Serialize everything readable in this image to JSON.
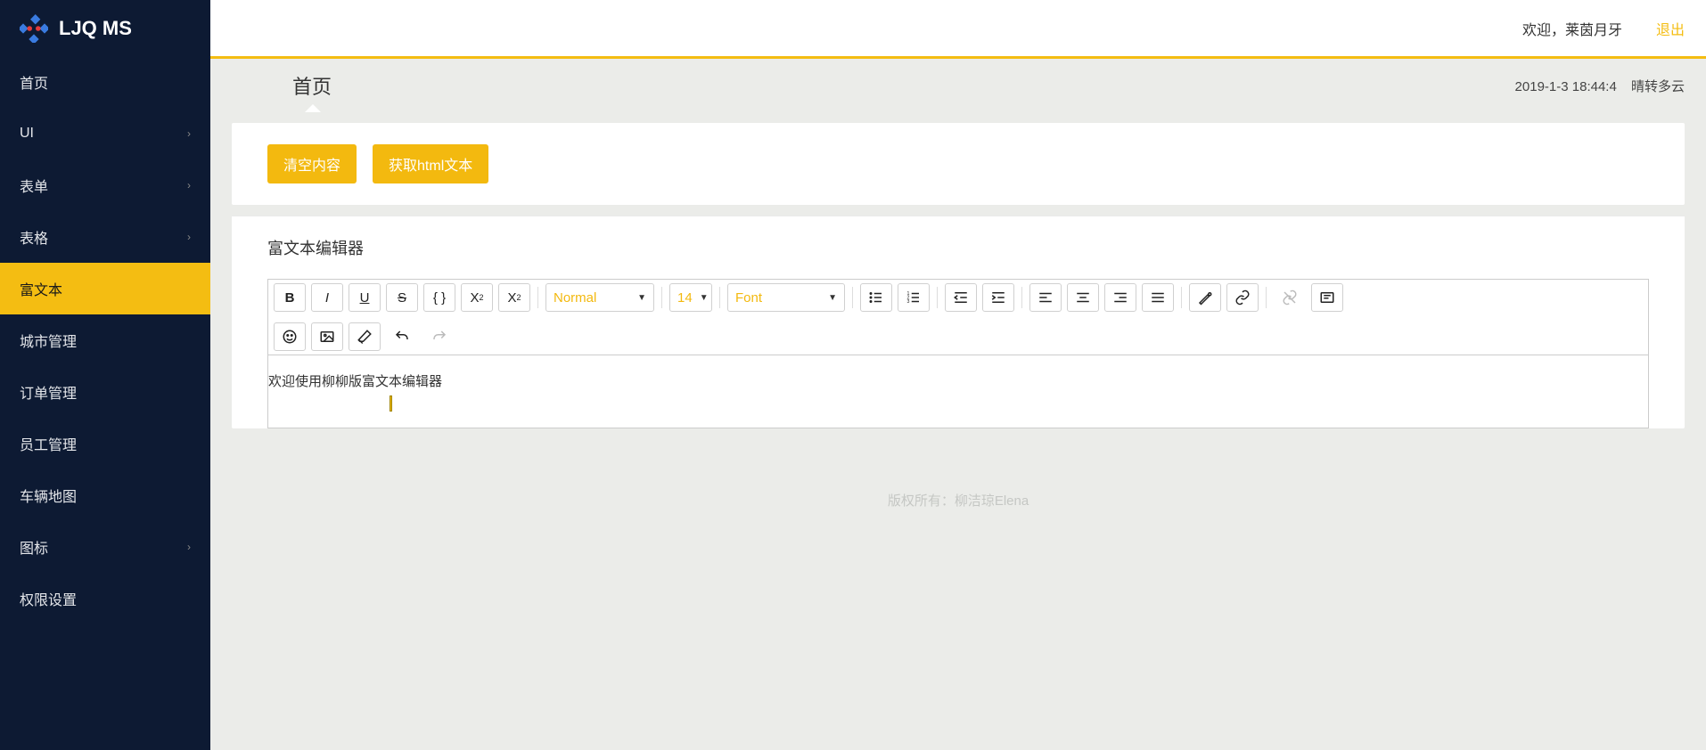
{
  "brand": "LJQ MS",
  "header": {
    "welcome_prefix": "欢迎，",
    "user_name": "莱茵月牙",
    "logout": "退出"
  },
  "sidebar": {
    "items": [
      {
        "label": "首页",
        "expandable": false
      },
      {
        "label": "UI",
        "expandable": true
      },
      {
        "label": "表单",
        "expandable": true
      },
      {
        "label": "表格",
        "expandable": true
      },
      {
        "label": "富文本",
        "expandable": false,
        "active": true
      },
      {
        "label": "城市管理",
        "expandable": false
      },
      {
        "label": "订单管理",
        "expandable": false
      },
      {
        "label": "员工管理",
        "expandable": false
      },
      {
        "label": "车辆地图",
        "expandable": false
      },
      {
        "label": "图标",
        "expandable": true
      },
      {
        "label": "权限设置",
        "expandable": false
      }
    ]
  },
  "breadcrumb": {
    "title": "首页"
  },
  "status": {
    "datetime": "2019-1-3 18:44:4",
    "weather": "晴转多云"
  },
  "actions": {
    "clear": "清空内容",
    "get_html": "获取html文本"
  },
  "panel_title": "富文本编辑器",
  "toolbar": {
    "heading": "Normal",
    "font_size": "14",
    "font_family": "Font"
  },
  "editor": {
    "content": "欢迎使用柳柳版富文本编辑器"
  },
  "footer": "版权所有：柳洁琼Elena"
}
